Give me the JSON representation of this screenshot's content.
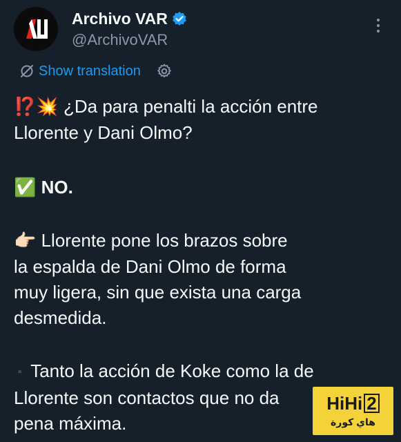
{
  "header": {
    "display_name": "Archivo VAR",
    "handle": "@ArchivoVAR",
    "avatar_text": "AV"
  },
  "translate": {
    "label": "Show translation"
  },
  "tweet": {
    "line1_emoji": "⁉️💥",
    "line1_text": " ¿Da para penalti la acción entre",
    "line2_text": "Llorente y Dani Olmo?",
    "verdict_emoji": "✅",
    "verdict_text": " NO.",
    "point1_emoji": "👉🏻",
    "point1_text": " Llorente pone los brazos sobre\nla espalda de Dani Olmo de forma\nmuy ligera, sin que exista una carga\ndesmedida.",
    "point2_bullet": "▪️",
    "point2_text": "  Tanto la acción de Koke como la de\nLlorente son contactos que no da\npena máxima."
  },
  "watermark": {
    "logo_main": "HiHi",
    "logo_num": "2",
    "subtitle": "هاي كورة"
  },
  "colors": {
    "background": "#15202b",
    "primary_text": "#f7f9f9",
    "secondary_text": "#8b98a5",
    "link": "#1d9bf0",
    "verified": "#1d9bf0",
    "watermark_bg": "#f3d23a"
  }
}
